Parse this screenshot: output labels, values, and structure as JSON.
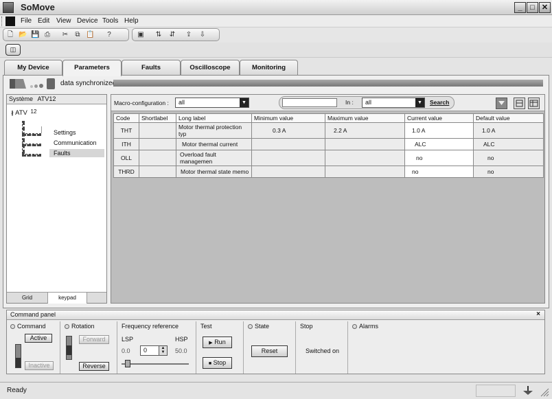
{
  "app": {
    "title": "SoMove"
  },
  "window_buttons": {
    "minimize": "_",
    "maximize": "□",
    "close": "✕"
  },
  "menu": [
    "File",
    "Edit",
    "View",
    "Device",
    "Tools",
    "Help"
  ],
  "tabs": [
    "My Device",
    "Parameters",
    "Faults",
    "Oscilloscope",
    "Monitoring"
  ],
  "sync": {
    "status": "data synchronized"
  },
  "tree": {
    "header_label": "Système",
    "header_value": "ATV12",
    "root": "ATV",
    "root_suffix": "12",
    "items": [
      "Settings",
      "Communication",
      "Faults"
    ]
  },
  "left_tabs": [
    "Grid",
    "keypad"
  ],
  "filter": {
    "macro_label": "Macro-configuration :",
    "macro_value": "all",
    "search_value": "",
    "in_label": "In :",
    "in_value": "all",
    "search_link": "Search"
  },
  "table": {
    "columns": [
      "Code",
      "Shortlabel",
      "Long label",
      "Minimum value",
      "Maximum value",
      "Current value",
      "Default value"
    ],
    "rows": [
      {
        "code": "THT",
        "short": "",
        "long": "Motor thermal protection typ",
        "min": "0.3 A",
        "max": "2.2 A",
        "current": "1.0 A",
        "default": "1.0 A"
      },
      {
        "code": "ITH",
        "short": "",
        "long": "Motor thermal current",
        "min": "",
        "max": "",
        "current": "ALC",
        "default": "ALC"
      },
      {
        "code": "OLL",
        "short": "",
        "long": "Overload fault managemen",
        "min": "",
        "max": "",
        "current": "no",
        "default": "no"
      },
      {
        "code": "THRD",
        "short": "",
        "long": "Motor thermal state memo",
        "min": "",
        "max": "",
        "current": "no",
        "default": "no"
      }
    ]
  },
  "command_panel": {
    "title": "Command panel",
    "close": "×",
    "command": {
      "title": "Command",
      "active": "Active",
      "inactive": "Inactive"
    },
    "rotation": {
      "title": "Rotation",
      "forward": "Forward",
      "reverse": "Reverse"
    },
    "frequency": {
      "title": "Frequency reference",
      "lsp_label": "LSP",
      "hsp_label": "HSP",
      "lsp_value": "0.0",
      "hsp_value": "50.0",
      "value": "0"
    },
    "test": {
      "title": "Test",
      "run": "Run",
      "stop": "Stop"
    },
    "state": {
      "title": "State",
      "reset": "Reset"
    },
    "stop": {
      "title": "Stop",
      "value": "Switched on"
    },
    "alarms": {
      "title": "Alarms"
    }
  },
  "status": {
    "text": "Ready"
  }
}
